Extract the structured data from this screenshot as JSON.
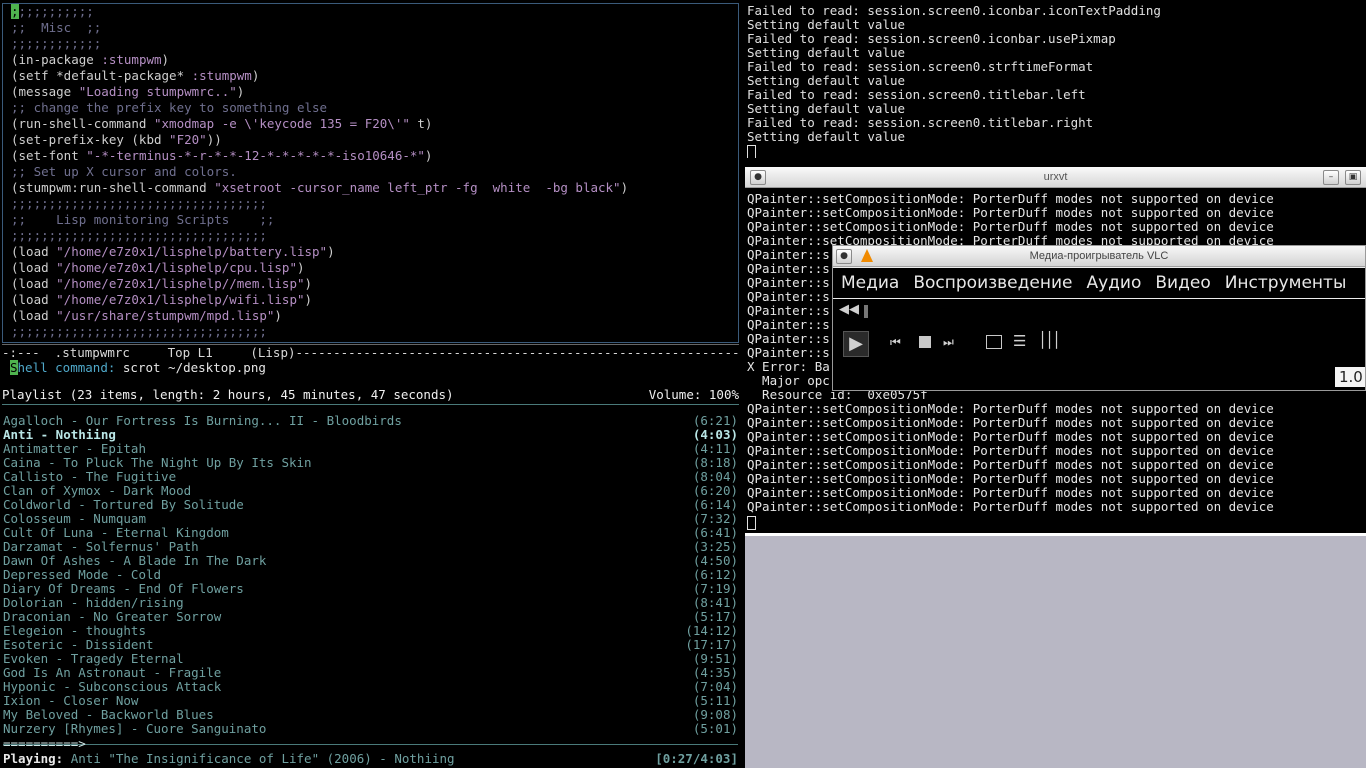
{
  "emacs": {
    "lines": [
      [
        {
          "t": ";;;;;;;;;;;",
          "c": "comment",
          "cursor": true
        }
      ],
      [
        {
          "t": ";;  Misc  ;;",
          "c": "comment"
        }
      ],
      [
        {
          "t": ";;;;;;;;;;;;",
          "c": "comment"
        }
      ],
      [
        {
          "t": "(in-package ",
          "c": "sym"
        },
        {
          "t": ":stumpwm",
          "c": "key"
        },
        {
          "t": ")",
          "c": "sym"
        }
      ],
      [
        {
          "t": "(setf *default-package* ",
          "c": "sym"
        },
        {
          "t": ":stumpwm",
          "c": "key"
        },
        {
          "t": ")",
          "c": "sym"
        }
      ],
      [
        {
          "t": "(message ",
          "c": "sym"
        },
        {
          "t": "\"Loading stumpwmrc..\"",
          "c": "string"
        },
        {
          "t": ")",
          "c": "sym"
        }
      ],
      [
        {
          "t": ";; change the prefix key to something else",
          "c": "comment"
        }
      ],
      [
        {
          "t": "(run-shell-command ",
          "c": "sym"
        },
        {
          "t": "\"xmodmap -e \\'keycode 135 = F20\\'\"",
          "c": "string"
        },
        {
          "t": " t)",
          "c": "sym"
        }
      ],
      [
        {
          "t": "(set-prefix-key (kbd ",
          "c": "sym"
        },
        {
          "t": "\"F20\"",
          "c": "string"
        },
        {
          "t": "))",
          "c": "sym"
        }
      ],
      [
        {
          "t": "(set-font ",
          "c": "sym"
        },
        {
          "t": "\"-*-terminus-*-r-*-*-12-*-*-*-*-*-iso10646-*\"",
          "c": "string"
        },
        {
          "t": ")",
          "c": "sym"
        }
      ],
      [
        {
          "t": ";; Set up X cursor and colors.",
          "c": "comment"
        }
      ],
      [
        {
          "t": "(stumpwm:run-shell-command ",
          "c": "sym"
        },
        {
          "t": "\"xsetroot -cursor_name left_ptr -fg  white  -bg black\"",
          "c": "string"
        },
        {
          "t": ")",
          "c": "sym"
        }
      ],
      [
        {
          "t": ";;;;;;;;;;;;;;;;;;;;;;;;;;;;;;;;;;",
          "c": "comment"
        }
      ],
      [
        {
          "t": ";;    Lisp monitoring Scripts    ;;",
          "c": "comment"
        }
      ],
      [
        {
          "t": ";;;;;;;;;;;;;;;;;;;;;;;;;;;;;;;;;;",
          "c": "comment"
        }
      ],
      [
        {
          "t": "(load ",
          "c": "sym"
        },
        {
          "t": "\"/home/e7z0x1/lisphelp/battery.lisp\"",
          "c": "string"
        },
        {
          "t": ")",
          "c": "sym"
        }
      ],
      [
        {
          "t": "(load ",
          "c": "sym"
        },
        {
          "t": "\"/home/e7z0x1/lisphelp/cpu.lisp\"",
          "c": "string"
        },
        {
          "t": ")",
          "c": "sym"
        }
      ],
      [
        {
          "t": "(load ",
          "c": "sym"
        },
        {
          "t": "\"/home/e7z0x1/lisphelp//mem.lisp\"",
          "c": "string"
        },
        {
          "t": ")",
          "c": "sym"
        }
      ],
      [
        {
          "t": "(load ",
          "c": "sym"
        },
        {
          "t": "\"/home/e7z0x1/lisphelp/wifi.lisp\"",
          "c": "string"
        },
        {
          "t": ")",
          "c": "sym"
        }
      ],
      [
        {
          "t": "(load ",
          "c": "sym"
        },
        {
          "t": "\"/usr/share/stumpwm/mpd.lisp\"",
          "c": "string"
        },
        {
          "t": ")",
          "c": "sym"
        }
      ],
      [
        {
          "t": ";;;;;;;;;;;;;;;;;;;;;;;;;;;;;;;;;;",
          "c": "comment"
        }
      ]
    ],
    "modeline": "-:---  .stumpwmrc     Top L1     (Lisp)--------------------------------------------------------------------------------",
    "minibuffer": {
      "cursor_char": "S",
      "prompt": "hell command: ",
      "value": "scrot ~/desktop.png"
    }
  },
  "ncmpc": {
    "header": "Playlist (23 items, length: 2 hours, 45 minutes, 47 seconds)",
    "volume": "Volume: 100%",
    "tracks": [
      {
        "title": "Agalloch - Our Fortress Is Burning... II - Bloodbirds",
        "dur": "(6:21)",
        "active": false
      },
      {
        "title": "Anti - Nothiing",
        "dur": "(4:03)",
        "active": true
      },
      {
        "title": "Antimatter - Epitah",
        "dur": "(4:11)",
        "active": false
      },
      {
        "title": "Caina - To Pluck The Night Up By Its Skin",
        "dur": "(8:18)",
        "active": false
      },
      {
        "title": "Callisto - The Fugitive",
        "dur": "(8:04)",
        "active": false
      },
      {
        "title": "Clan of Xymox - Dark Mood",
        "dur": "(6:20)",
        "active": false
      },
      {
        "title": "Coldworld - Tortured By Solitude",
        "dur": "(6:14)",
        "active": false
      },
      {
        "title": "Colosseum - Numquam",
        "dur": "(7:32)",
        "active": false
      },
      {
        "title": "Cult Of Luna - Eternal Kingdom",
        "dur": "(6:41)",
        "active": false
      },
      {
        "title": "Darzamat - Solfernus' Path",
        "dur": "(3:25)",
        "active": false
      },
      {
        "title": "Dawn Of Ashes - A Blade In The Dark",
        "dur": "(4:50)",
        "active": false
      },
      {
        "title": "Depressed Mode - Cold",
        "dur": "(6:12)",
        "active": false
      },
      {
        "title": "Diary Of Dreams - End Of Flowers",
        "dur": "(7:19)",
        "active": false
      },
      {
        "title": "Dolorian - hidden/rising",
        "dur": "(8:41)",
        "active": false
      },
      {
        "title": "Draconian - No Greater Sorrow",
        "dur": "(5:17)",
        "active": false
      },
      {
        "title": "Elegeion - thoughts",
        "dur": "(14:12)",
        "active": false
      },
      {
        "title": "Esoteric - Dissident",
        "dur": "(17:17)",
        "active": false
      },
      {
        "title": "Evoken - Tragedy Eternal",
        "dur": "(9:51)",
        "active": false
      },
      {
        "title": "God Is An Astronaut - Fragile",
        "dur": "(4:35)",
        "active": false
      },
      {
        "title": "Hyponic - Subconscious Attack",
        "dur": "(7:04)",
        "active": false
      },
      {
        "title": "Ixion - Closer Now",
        "dur": "(5:11)",
        "active": false
      },
      {
        "title": "My Beloved - Backworld Blues",
        "dur": "(9:08)",
        "active": false
      },
      {
        "title": "Nurzery [Rhymes] - Cuore Sanguinato",
        "dur": "(5:01)",
        "active": false
      }
    ],
    "progress_bar": "==========>",
    "progress_fraction": 0.112,
    "status_label": "Playing:",
    "status_text": " Anti \"The Insignificance of Life\" (2006) - Nothiing",
    "status_time": "[0:27/4:03]"
  },
  "term_top": {
    "lines": [
      "Failed to read: session.screen0.iconbar.iconTextPadding",
      "Setting default value",
      "Failed to read: session.screen0.iconbar.usePixmap",
      "Setting default value",
      "Failed to read: session.screen0.strftimeFormat",
      "Setting default value",
      "Failed to read: session.screen0.titlebar.left",
      "Setting default value",
      "Failed to read: session.screen0.titlebar.right",
      "Setting default value"
    ]
  },
  "urxvt": {
    "title": "urxvt",
    "lines": [
      "QPainter::setCompositionMode: PorterDuff modes not supported on device",
      "QPainter::setCompositionMode: PorterDuff modes not supported on device",
      "QPainter::setCompositionMode: PorterDuff modes not supported on device",
      "QPainter::setCompositionMode: PorterDuff modes not supported on device",
      "QPainter::s",
      "QPainter::s",
      "QPainter::s",
      "QPainter::s",
      "QPainter::s",
      "QPainter::s",
      "QPainter::s",
      "QPainter::s",
      "X Error: Ba",
      "  Major opc",
      "  Resource id:  0xe0575f",
      "QPainter::setCompositionMode: PorterDuff modes not supported on device",
      "QPainter::setCompositionMode: PorterDuff modes not supported on device",
      "QPainter::setCompositionMode: PorterDuff modes not supported on device",
      "QPainter::setCompositionMode: PorterDuff modes not supported on device",
      "QPainter::setCompositionMode: PorterDuff modes not supported on device",
      "QPainter::setCompositionMode: PorterDuff modes not supported on device",
      "QPainter::setCompositionMode: PorterDuff modes not supported on device",
      "QPainter::setCompositionMode: PorterDuff modes not supported on device"
    ]
  },
  "vlc": {
    "title": "Медиа-проигрыватель VLC",
    "menus": [
      "Медиа",
      "Воспроизведение",
      "Аудио",
      "Видео",
      "Инструменты"
    ],
    "zoom": "1.0",
    "icons": [
      "vlc-cone-icon",
      "play-icon",
      "previous-icon",
      "stop-icon",
      "next-icon",
      "fullscreen-icon",
      "playlist-icon",
      "equalizer-icon",
      "seek-back-icon"
    ]
  },
  "colors": {
    "emacs_comment": "#6f6f8f",
    "emacs_string": "#b58fc4",
    "ncmpc_track": "#6fa0a0",
    "cursor": "#4fb34f",
    "desktop": "#b8b7c4",
    "vlc_accent": "#f08a00"
  }
}
